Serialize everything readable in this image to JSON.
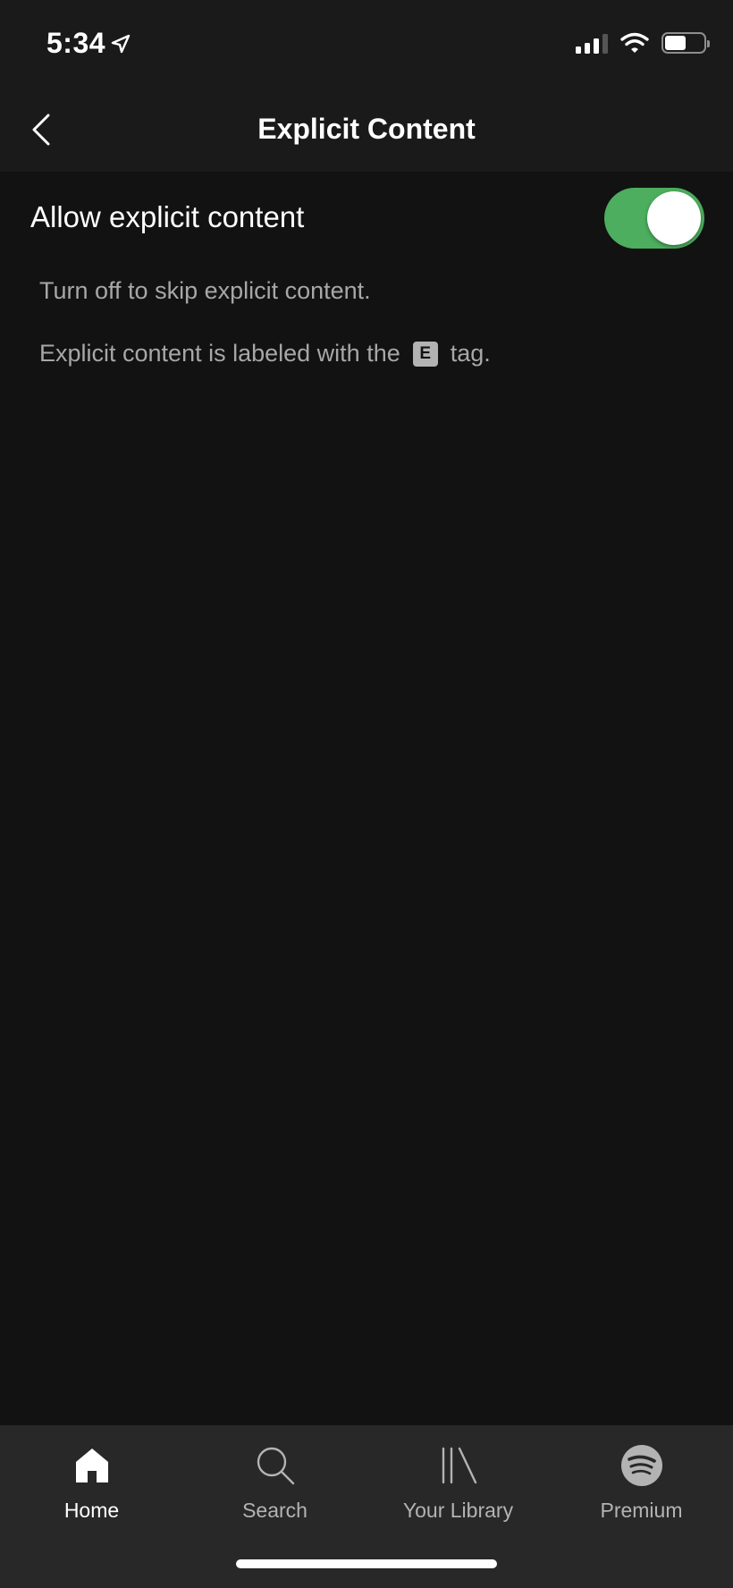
{
  "status_bar": {
    "time": "5:34",
    "location_icon": "location-arrow-icon",
    "signal_icon": "cellular-signal-icon",
    "wifi_icon": "wifi-icon",
    "battery_icon": "battery-icon",
    "battery_level": 0.55
  },
  "header": {
    "title": "Explicit Content",
    "back_icon": "chevron-left-icon"
  },
  "setting": {
    "label": "Allow explicit content",
    "enabled": true,
    "toggle_color": "#4cae5e"
  },
  "help": {
    "line1": "Turn off to skip explicit content.",
    "line2_before": "Explicit content is labeled with the",
    "tag": "E",
    "line2_after": "tag."
  },
  "tabs": [
    {
      "label": "Home",
      "icon": "home-icon",
      "active": true
    },
    {
      "label": "Search",
      "icon": "search-icon",
      "active": false
    },
    {
      "label": "Your Library",
      "icon": "library-icon",
      "active": false
    },
    {
      "label": "Premium",
      "icon": "spotify-logo-icon",
      "active": false
    }
  ]
}
